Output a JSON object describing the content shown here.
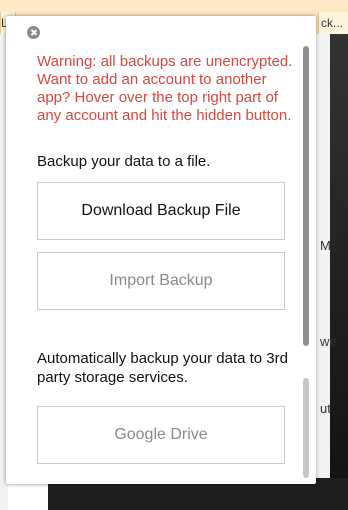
{
  "background": {
    "tab_left_label": "L",
    "tab_right_label": "ck...",
    "fragments": [
      "M",
      "we",
      "ut"
    ]
  },
  "popup": {
    "warning": "Warning: all backups are unencrypted. Want to add an account to another app? Hover over the top right part of any account and hit the hidden button.",
    "backup_file_text": "Backup your data to a file.",
    "download_button": "Download Backup File",
    "import_button": "Import Backup",
    "auto_backup_text": "Automatically backup your data to 3rd party storage services.",
    "google_drive_button": "Google Drive"
  },
  "colors": {
    "warning": "#d9473d",
    "muted": "#8a8a8a",
    "tab_bg": "#fde8c6"
  },
  "icons": {
    "close": "close-icon"
  }
}
